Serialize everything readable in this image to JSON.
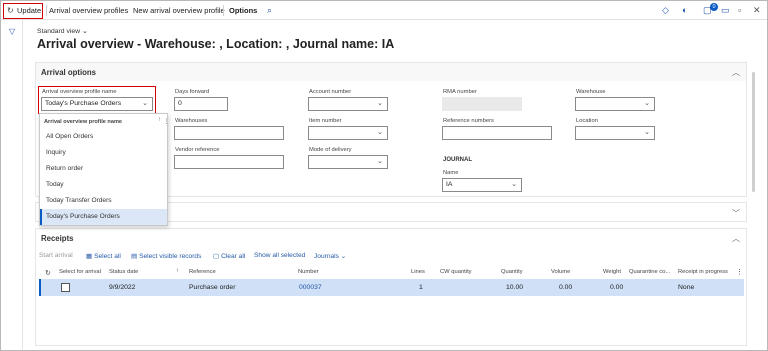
{
  "actionbar": {
    "update": "Update",
    "profiles": "Arrival overview profiles",
    "new_profile": "New arrival overview profile",
    "options": "Options",
    "notification_count": "0"
  },
  "page": {
    "standard_view": "Standard view",
    "title": "Arrival overview - Warehouse: , Location: , Journal name: IA"
  },
  "arrival_options": {
    "section_title": "Arrival options",
    "profile_label": "Arrival overview profile name",
    "profile_value": "Today's Purchase Orders",
    "days_forward_label": "Days forward",
    "days_forward_value": "0",
    "warehouses_label": "Warehouses",
    "vendor_ref_label": "Vendor reference",
    "account_label": "Account number",
    "item_label": "Item number",
    "mode_label": "Mode of delivery",
    "rma_label": "RMA number",
    "ref_numbers_label": "Reference numbers",
    "journal_heading": "JOURNAL",
    "name_label": "Name",
    "name_value": "IA",
    "warehouse_label": "Warehouse",
    "location_label": "Location"
  },
  "profile_dropdown": {
    "header": "Arrival overview profile name",
    "options": [
      "All Open Orders",
      "Inquiry",
      "Return order",
      "Today",
      "Today Transfer Orders",
      "Today's Purchase Orders"
    ],
    "selected": "Today's Purchase Orders"
  },
  "receipts": {
    "section_title": "Receipts",
    "toolbar": {
      "start_arrival": "Start arrival",
      "select_all": "Select all",
      "select_visible": "Select visible records",
      "clear_all": "Clear all",
      "show_all_selected": "Show all selected",
      "journals": "Journals"
    },
    "columns": [
      "Select for arrival",
      "Status date",
      "Reference",
      "Number",
      "Lines",
      "CW quantity",
      "Quantity",
      "Volume",
      "Weight",
      "Quarantine co...",
      "Receipt in progress"
    ],
    "rows": [
      {
        "status_date": "9/9/2022",
        "reference": "Purchase order",
        "number": "000037",
        "lines": "1",
        "cw_quantity": "",
        "quantity": "10.00",
        "volume": "0.00",
        "weight": "0.00",
        "quarantine": "",
        "receipt_in_progress": "None"
      }
    ]
  },
  "colors": {
    "accent": "#0a5bc4",
    "highlight": "#d20000",
    "selected_row": "#cfe0f7"
  }
}
